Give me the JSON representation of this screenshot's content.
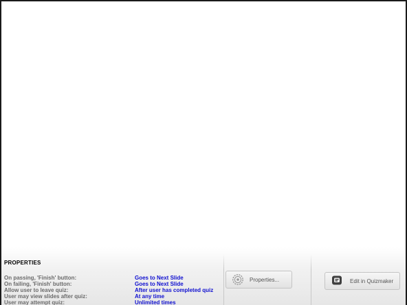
{
  "properties_panel": {
    "heading": "PROPERTIES",
    "rows": [
      {
        "label": "On passing, 'Finish' button:",
        "value": "Goes to Next Slide"
      },
      {
        "label": "On failing, 'Finish' button:",
        "value": "Goes to Next Slide"
      },
      {
        "label": "Allow user to leave quiz:",
        "value": "After user has completed quiz"
      },
      {
        "label": "User may view slides after quiz:",
        "value": "At any time"
      },
      {
        "label": "User may attempt quiz:",
        "value": "Unlimited times"
      }
    ],
    "properties_button": {
      "label": "Properties...",
      "icon": "gear-icon"
    },
    "edit_button": {
      "label": "Edit in Quizmaker",
      "icon": "quizmaker-icon"
    }
  },
  "colors": {
    "label": "#6b6b6b",
    "value": "#1010d0",
    "frame_border": "#1a1a1a"
  }
}
